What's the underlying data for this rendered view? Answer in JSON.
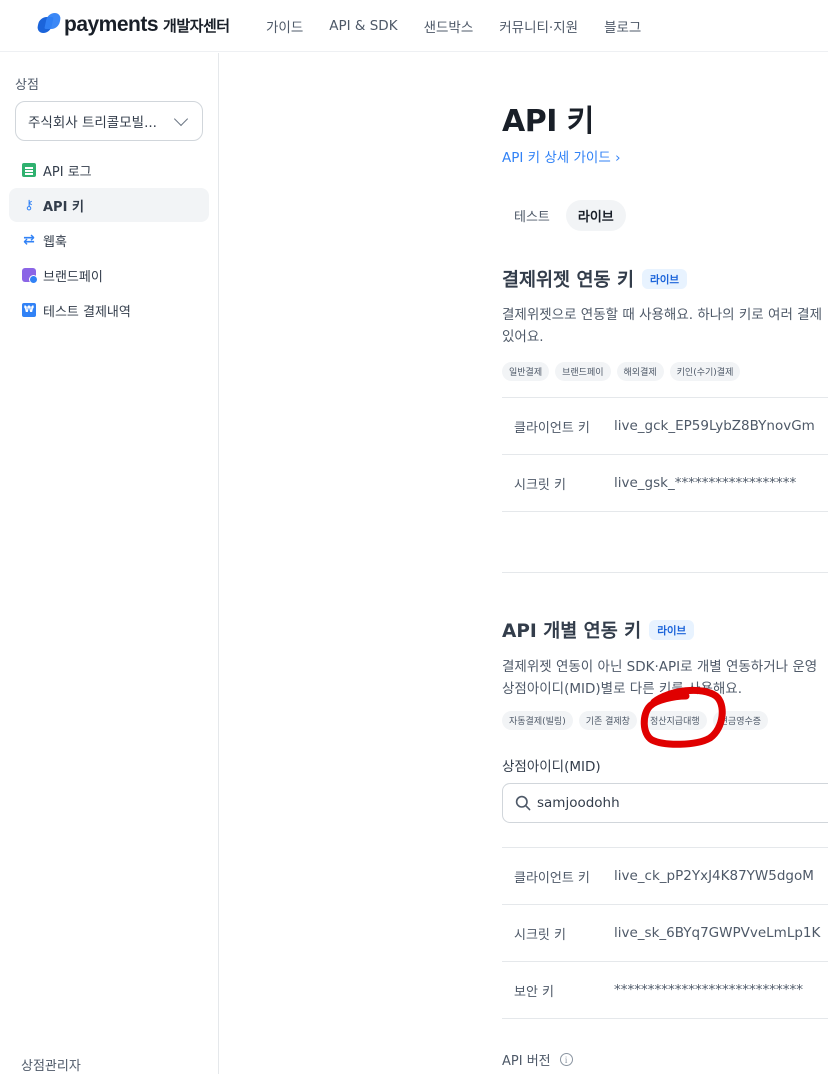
{
  "header": {
    "logo_text": "payments",
    "logo_sub": "개발자센터",
    "nav": [
      "가이드",
      "API & SDK",
      "샌드박스",
      "커뮤니티·지원",
      "블로그"
    ]
  },
  "sidebar": {
    "store_label": "상점",
    "store_value": "주식회사 트리콜모빌...",
    "items": [
      {
        "label": "API 로그",
        "icon": "log-icon"
      },
      {
        "label": "API 키",
        "icon": "key-icon"
      },
      {
        "label": "웹훅",
        "icon": "webhook-icon"
      },
      {
        "label": "브랜드페이",
        "icon": "brandpay-icon"
      },
      {
        "label": "테스트 결제내역",
        "icon": "test-payment-icon"
      }
    ],
    "footer_label": "상점관리자"
  },
  "main": {
    "title": "API 키",
    "guide_link": "API 키 상세 가이드",
    "tabs": [
      {
        "label": "테스트",
        "active": false
      },
      {
        "label": "라이브",
        "active": true
      }
    ],
    "widget_section": {
      "title": "결제위젯 연동 키",
      "badge": "라이브",
      "desc_line1": "결제위젯으로 연동할 때 사용해요. 하나의 키로 여러 결제",
      "desc_line2": "있어요.",
      "chips": [
        "일반결제",
        "브랜드페이",
        "해외결제",
        "키인(수기)결제"
      ],
      "rows": [
        {
          "key": "클라이언트 키",
          "value": "live_gck_EP59LybZ8BYnovGm"
        },
        {
          "key": "시크릿 키",
          "value": "live_gsk_******************"
        }
      ]
    },
    "api_section": {
      "title": "API 개별 연동 키",
      "badge": "라이브",
      "desc_line1": "결제위젯 연동이 아닌 SDK·API로 개별 연동하거나 운영",
      "desc_line2": "상점아이디(MID)별로 다른 키를 사용해요.",
      "chips": [
        "자동결제(빌링)",
        "기존 결제창",
        "정산지급대행",
        "현금영수증"
      ],
      "mid_label": "상점아이디(MID)",
      "search_value": "samjoodohh",
      "rows": [
        {
          "key": "클라이언트 키",
          "value": "live_ck_pP2YxJ4K87YW5dgoM"
        },
        {
          "key": "시크릿 키",
          "value": "live_sk_6BYq7GWPVveLmLp1K"
        },
        {
          "key": "보안 키",
          "value": "****************************"
        }
      ],
      "api_version_label": "API 버전"
    }
  },
  "colors": {
    "accent": "#3182f6",
    "badge_bg": "#e8f3ff",
    "annotation": "#e00000"
  }
}
